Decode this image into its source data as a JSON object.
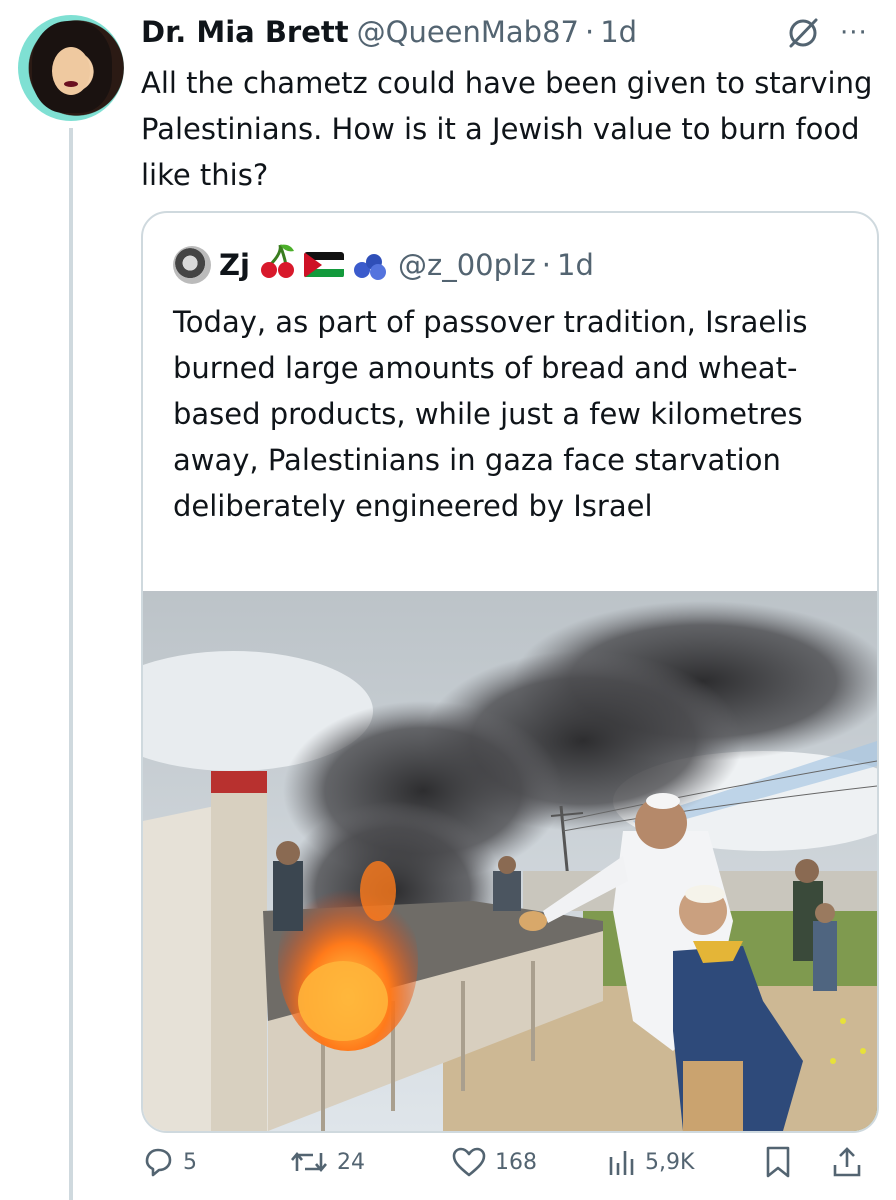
{
  "tweet": {
    "author_name": "Dr. Mia Brett",
    "author_handle": "@QueenMab87",
    "separator": "·",
    "time": "1d",
    "text": "All the chametz could have been given to starving Palestinians. How is it a Jewish value to burn food like this?",
    "more_label": "···"
  },
  "quote": {
    "author_name": "Zj",
    "emojis": [
      "cherry",
      "palestine-flag",
      "blueberry"
    ],
    "author_handle": "@z_00pIz",
    "separator": "·",
    "time": "1d",
    "text": "Today, as part of passover tradition, Israelis burned large amounts of bread and wheat-based products, while just a few kilometres away, Palestinians in gaza face starvation deliberately engineered by Israel"
  },
  "actions": {
    "replies": "5",
    "reposts": "24",
    "likes": "168",
    "views": "5,9K"
  },
  "colors": {
    "text": "#0f1419",
    "secondary": "#536471",
    "border": "#cfd9de"
  }
}
